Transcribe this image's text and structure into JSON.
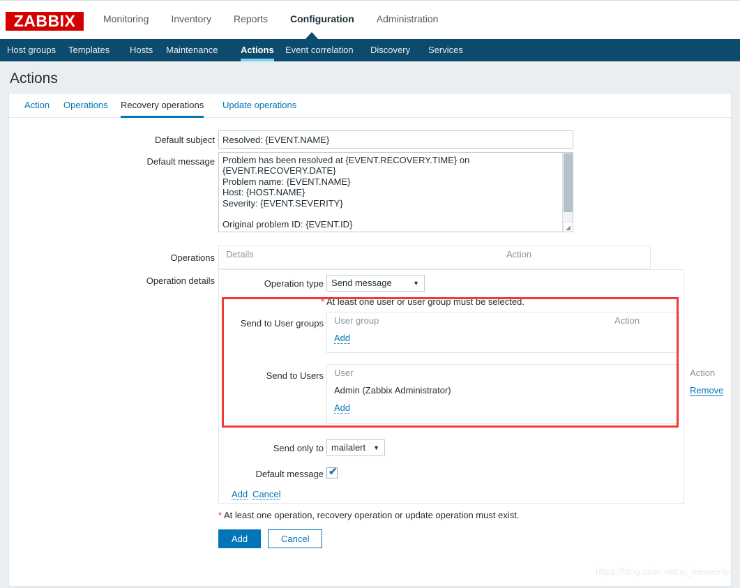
{
  "brand": {
    "logo_text": "ZABBIX",
    "logo_bg": "#d40000"
  },
  "theme": {
    "subnav_bg": "#0c4a6e",
    "accent": "#0275b8",
    "highlight": "#f23a36",
    "tab_underline": "#7dd3f0"
  },
  "main_nav": {
    "items": [
      {
        "label": "Monitoring",
        "selected": false
      },
      {
        "label": "Inventory",
        "selected": false
      },
      {
        "label": "Reports",
        "selected": false
      },
      {
        "label": "Configuration",
        "selected": true
      },
      {
        "label": "Administration",
        "selected": false
      }
    ]
  },
  "sub_nav": {
    "items": [
      {
        "label": "Host groups",
        "selected": false
      },
      {
        "label": "Templates",
        "selected": false
      },
      {
        "label": "Hosts",
        "selected": false
      },
      {
        "label": "Maintenance",
        "selected": false
      },
      {
        "label": "Actions",
        "selected": true
      },
      {
        "label": "Event correlation",
        "selected": false
      },
      {
        "label": "Discovery",
        "selected": false
      },
      {
        "label": "Services",
        "selected": false
      }
    ]
  },
  "page": {
    "title": "Actions"
  },
  "tabs": {
    "items": [
      {
        "label": "Action",
        "selected": false
      },
      {
        "label": "Operations",
        "selected": false
      },
      {
        "label": "Recovery operations",
        "selected": true
      },
      {
        "label": "Update operations",
        "selected": false
      }
    ]
  },
  "form": {
    "default_subject": {
      "label": "Default subject",
      "value": "Resolved: {EVENT.NAME}"
    },
    "default_message": {
      "label": "Default message",
      "value": "Problem has been resolved at {EVENT.RECOVERY.TIME} on\n{EVENT.RECOVERY.DATE}\nProblem name: {EVENT.NAME}\nHost: {HOST.NAME}\nSeverity: {EVENT.SEVERITY}\n\nOriginal problem ID: {EVENT.ID}\n{TRIGGER.URL}"
    },
    "operations": {
      "label": "Operations",
      "headers": {
        "details": "Details",
        "action": "Action"
      },
      "rows": []
    },
    "operation_details": {
      "label": "Operation details",
      "operation_type": {
        "label": "Operation type",
        "value": "Send message",
        "options": [
          "Send message"
        ]
      },
      "validation_note": {
        "star": "*",
        "text": " At least one user or user group must be selected."
      },
      "send_to_user_groups": {
        "label": "Send to User groups",
        "headers": {
          "name": "User group",
          "action": "Action"
        },
        "rows": [],
        "add_label": "Add"
      },
      "send_to_users": {
        "label": "Send to Users",
        "headers": {
          "name": "User",
          "action": "Action"
        },
        "rows": [
          {
            "name": "Admin (Zabbix Administrator)",
            "action": "Remove"
          }
        ],
        "add_label": "Add"
      },
      "send_only_to": {
        "label": "Send only to",
        "value": "mailalert",
        "options": [
          "mailalert"
        ]
      },
      "default_message_checkbox": {
        "label": "Default message",
        "checked": true,
        "mark": "✔"
      },
      "inline_actions": {
        "add": "Add",
        "cancel": "Cancel"
      }
    },
    "form_note": {
      "star": "*",
      "text": " At least one operation, recovery operation or update operation must exist."
    },
    "footer_buttons": {
      "add": "Add",
      "cancel": "Cancel"
    }
  },
  "watermark": {
    "text": "https://blog.csdn.net/ai_benwoniu"
  }
}
